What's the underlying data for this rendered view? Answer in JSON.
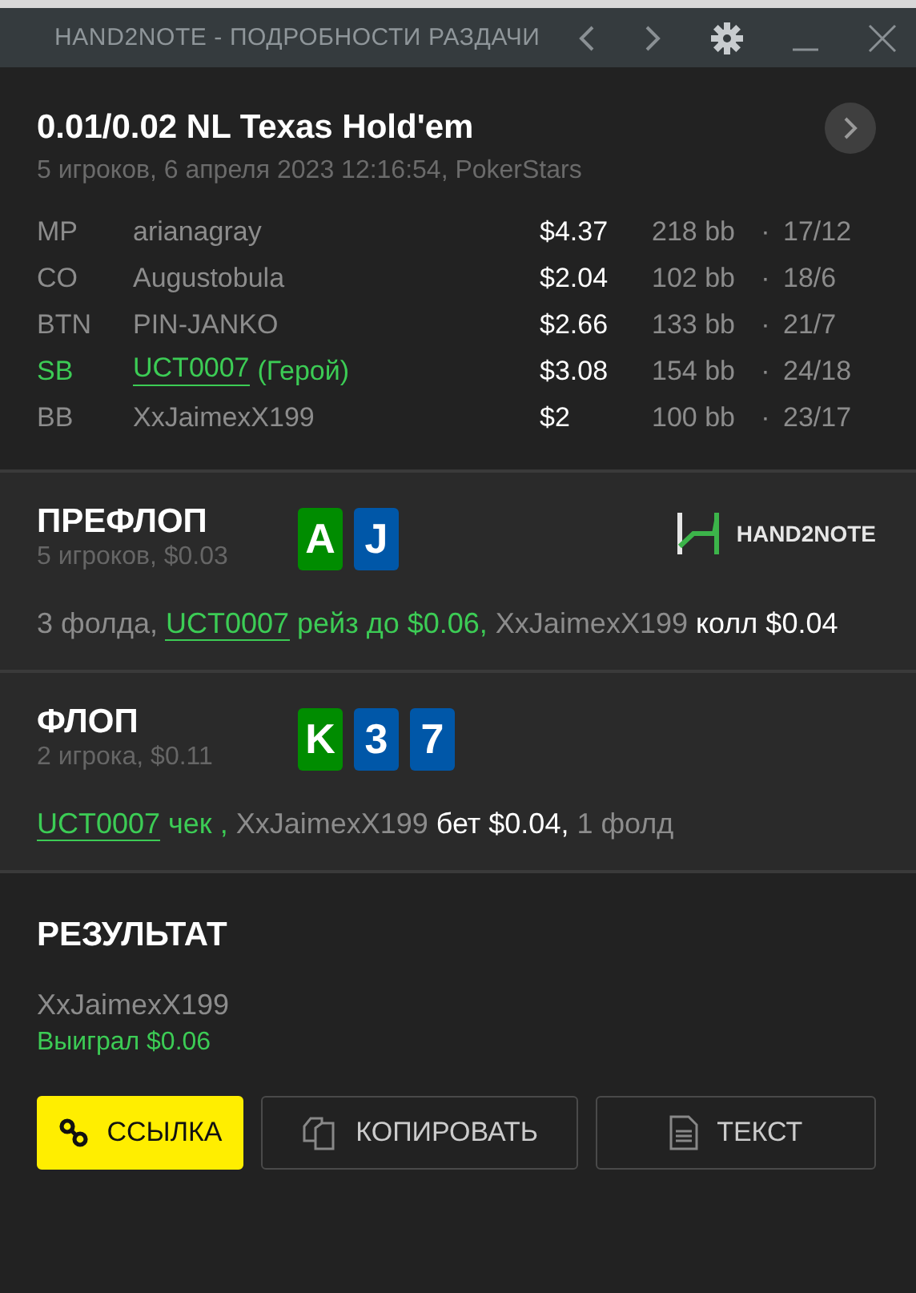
{
  "window": {
    "title": "HAND2NOTE - ПОДРОБНОСТИ РАЗДАЧИ"
  },
  "hand": {
    "title": "0.01/0.02 NL Texas Hold'em",
    "subtitle": "5 игроков, 6 апреля 2023 12:16:54, PokerStars"
  },
  "players": [
    {
      "position": "MP",
      "name": "arianagray",
      "hero": false,
      "stack": "$4.37",
      "bb": "218 bb",
      "separator": "·",
      "stats": "17/12"
    },
    {
      "position": "CO",
      "name": "Augustobula",
      "hero": false,
      "stack": "$2.04",
      "bb": "102 bb",
      "separator": "·",
      "stats": "18/6"
    },
    {
      "position": "BTN",
      "name": "PIN-JANKO",
      "hero": false,
      "stack": "$2.66",
      "bb": "133 bb",
      "separator": "·",
      "stats": "21/7"
    },
    {
      "position": "SB",
      "name": "UCT0007",
      "hero": true,
      "hero_label": "(Герой)",
      "stack": "$3.08",
      "bb": "154 bb",
      "separator": "·",
      "stats": "24/18"
    },
    {
      "position": "BB",
      "name": "XxJaimexX199",
      "hero": false,
      "stack": "$2",
      "bb": "100 bb",
      "separator": "·",
      "stats": "23/17"
    }
  ],
  "streets": [
    {
      "title": "ПРЕФЛОП",
      "subtitle": "5 игроков, $0.03",
      "logo_text": "HAND2NOTE",
      "cards": [
        {
          "rank": "A",
          "color": "#008c00"
        },
        {
          "rank": "J",
          "color": "#0057a8"
        }
      ],
      "actions": [
        {
          "kind": "plain",
          "text": "3 фолда, "
        },
        {
          "kind": "hero",
          "text": "UCT0007"
        },
        {
          "kind": "hero_action",
          "text": " рейз до $0.06, "
        },
        {
          "kind": "plain",
          "text": "XxJaimexX199 "
        },
        {
          "kind": "action",
          "text": "колл $0.04"
        }
      ]
    },
    {
      "title": "ФЛОП",
      "subtitle": "2 игрока, $0.11",
      "cards": [
        {
          "rank": "K",
          "color": "#008c00"
        },
        {
          "rank": "3",
          "color": "#0057a8"
        },
        {
          "rank": "7",
          "color": "#0057a8"
        }
      ],
      "actions": [
        {
          "kind": "hero",
          "text": "UCT0007"
        },
        {
          "kind": "hero_action",
          "text": " чек , "
        },
        {
          "kind": "plain",
          "text": "XxJaimexX199 "
        },
        {
          "kind": "action",
          "text": "бет $0.04, "
        },
        {
          "kind": "plain",
          "text": "1 фолд"
        }
      ]
    }
  ],
  "result": {
    "title": "РЕЗУЛЬТАТ",
    "winner": "XxJaimexX199",
    "amount": "Выиграл $0.06"
  },
  "buttons": [
    {
      "kind": "link",
      "label": "ССЫЛКА",
      "primary": true
    },
    {
      "kind": "copy",
      "label": "КОПИРОВАТЬ",
      "primary": false
    },
    {
      "kind": "text",
      "label": "ТЕКСТ",
      "primary": false
    }
  ]
}
